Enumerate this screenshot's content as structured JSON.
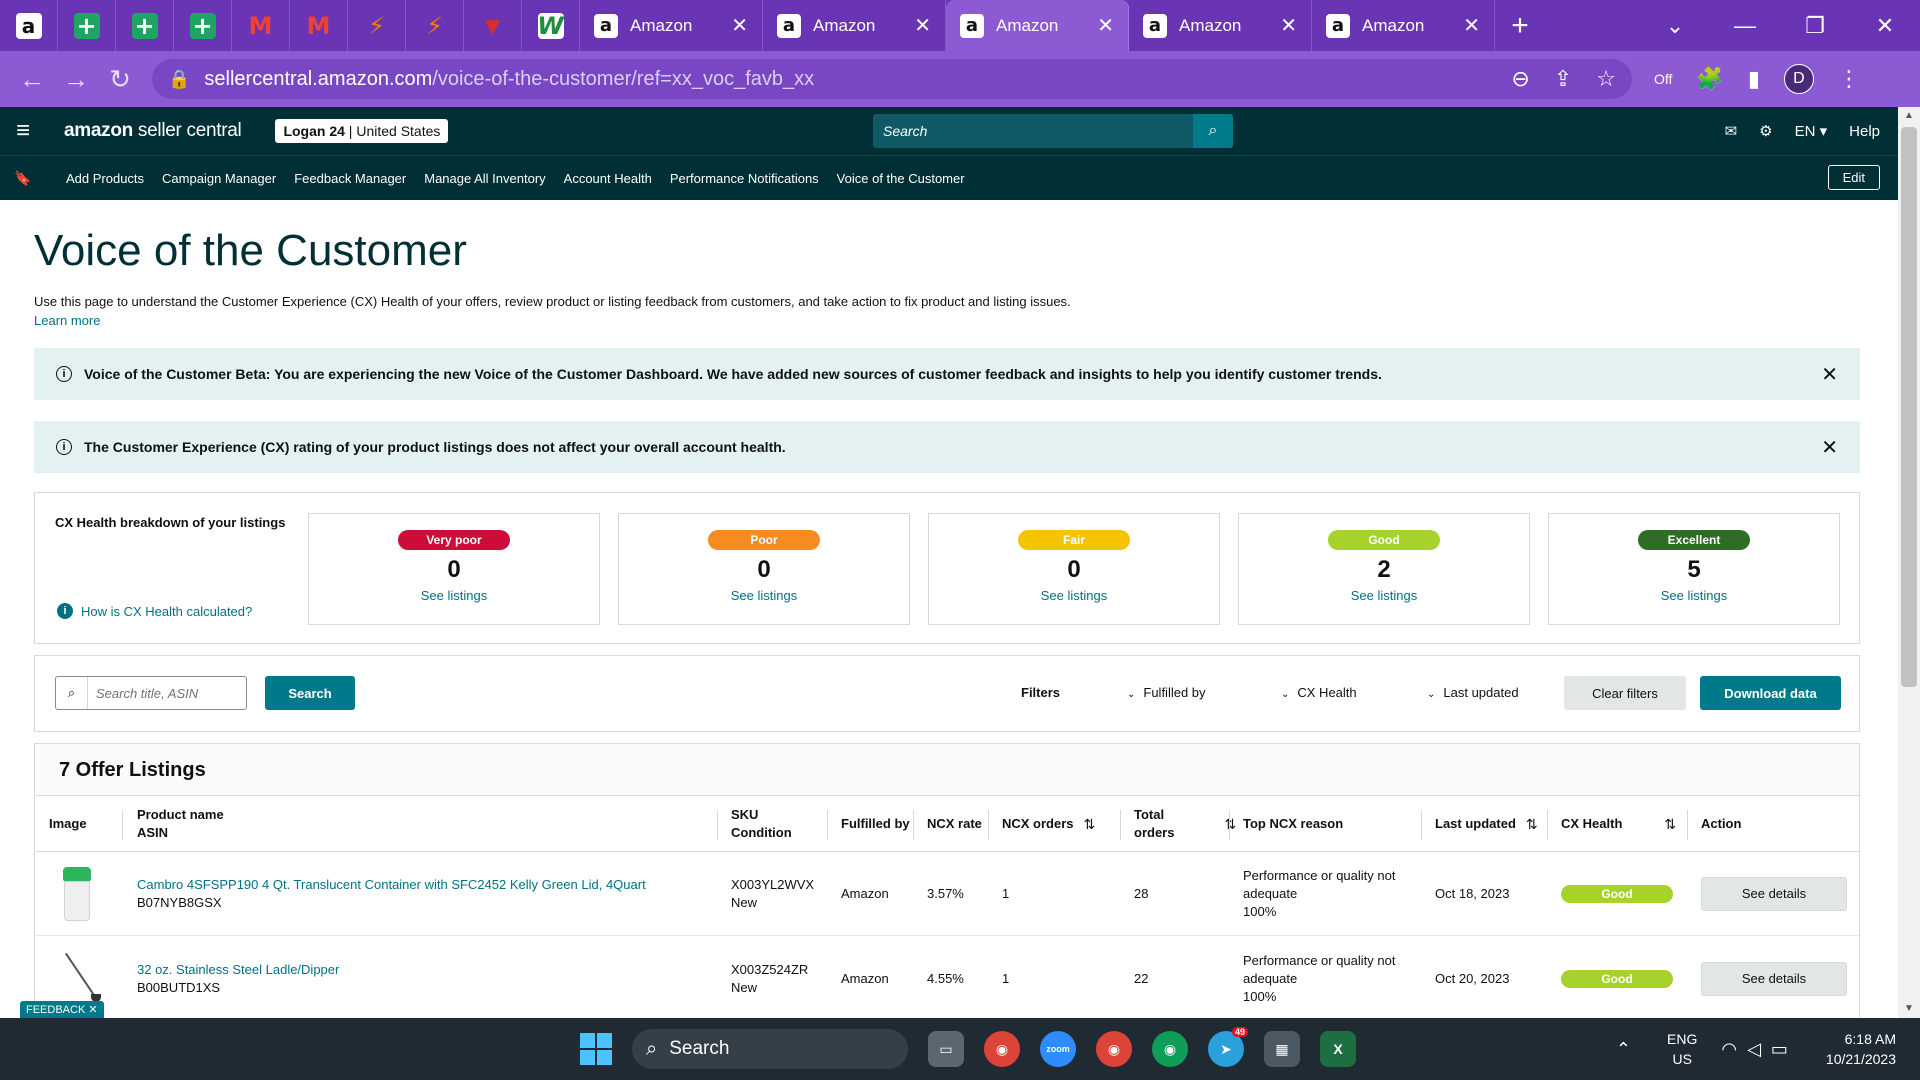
{
  "browser": {
    "tabs": [
      {
        "label": "Amazon",
        "active": false
      },
      {
        "label": "Amazon",
        "active": false
      },
      {
        "label": "Amazon",
        "active": true
      },
      {
        "label": "Amazon",
        "active": false
      },
      {
        "label": "Amazon",
        "active": false
      }
    ],
    "url_host": "sellercentral.amazon.com",
    "url_path": "/voice-of-the-customer/ref=xx_voc_favb_xx",
    "profile_initial": "D",
    "extension_badge": "Off"
  },
  "header": {
    "brand_bold": "amazon",
    "brand_rest": " seller central",
    "store_name": "Logan 24",
    "store_region": " | United States",
    "search_placeholder": "Search",
    "language": "EN",
    "help": "Help"
  },
  "bookmarks": {
    "items": [
      "Add Products",
      "Campaign Manager",
      "Feedback Manager",
      "Manage All Inventory",
      "Account Health",
      "Performance Notifications",
      "Voice of the Customer"
    ],
    "edit_label": "Edit"
  },
  "page": {
    "title": "Voice of the Customer",
    "intro": "Use this page to understand the Customer Experience (CX) Health of your offers, review product or listing feedback from customers, and take action to fix product and listing issues.",
    "learn_more": "Learn more",
    "banner1": "Voice of the Customer Beta: You are experiencing the new Voice of the Customer Dashboard. We have added new sources of customer feedback and insights to help you identify customer trends.",
    "banner2": "The Customer Experience (CX) rating of your product listings does not affect your overall account health."
  },
  "cx": {
    "title": "CX Health breakdown of your listings",
    "help_link": "How is CX Health calculated?",
    "cards": [
      {
        "label": "Very poor",
        "count": "0",
        "link": "See listings",
        "color": "#cc0c39"
      },
      {
        "label": "Poor",
        "count": "0",
        "link": "See listings",
        "color": "#f68b1f"
      },
      {
        "label": "Fair",
        "count": "0",
        "link": "See listings",
        "color": "#f5c400"
      },
      {
        "label": "Good",
        "count": "2",
        "link": "See listings",
        "color": "#a7d22b"
      },
      {
        "label": "Excellent",
        "count": "5",
        "link": "See listings",
        "color": "#2e6d24"
      }
    ]
  },
  "filters": {
    "search_placeholder": "Search title, ASIN",
    "search_button": "Search",
    "label": "Filters",
    "fulfilled_by": "Fulfilled by",
    "cx_health": "CX Health",
    "last_updated": "Last updated",
    "clear": "Clear filters",
    "download": "Download data"
  },
  "listings": {
    "title": "7 Offer Listings",
    "headers": {
      "image": "Image",
      "product_name": "Product name",
      "asin": "ASIN",
      "sku": "SKU",
      "condition": "Condition",
      "fulfilled_by": "Fulfilled by",
      "ncx_rate": "NCX rate",
      "ncx_orders": "NCX orders",
      "total": "Total",
      "orders": "orders",
      "top_reason": "Top NCX reason",
      "last_updated": "Last updated",
      "cx_health": "CX Health",
      "action": "Action"
    },
    "rows": [
      {
        "name": "Cambro 4SFSPP190 4 Qt. Translucent Container with SFC2452 Kelly Green Lid, 4Quart",
        "asin": "B07NYB8GSX",
        "sku": "X003YL2WVX",
        "condition": "New",
        "fulfilled": "Amazon",
        "ncx_rate": "3.57%",
        "ncx_orders": "1",
        "total_orders": "28",
        "reason_1": "Performance or quality not",
        "reason_2": "adequate",
        "reason_pct": "100%",
        "updated": "Oct 18, 2023",
        "health": "Good",
        "action": "See details"
      },
      {
        "name": "32 oz. Stainless Steel Ladle/Dipper",
        "asin": "B00BUTD1XS",
        "sku": "X003Z524ZR",
        "condition": "New",
        "fulfilled": "Amazon",
        "ncx_rate": "4.55%",
        "ncx_orders": "1",
        "total_orders": "22",
        "reason_1": "Performance or quality not",
        "reason_2": "adequate",
        "reason_pct": "100%",
        "updated": "Oct 20, 2023",
        "health": "Good",
        "action": "See details"
      }
    ]
  },
  "feedback_tab": "FEEDBACK",
  "taskbar": {
    "search": "Search",
    "lang_1": "ENG",
    "lang_2": "US",
    "time": "6:18 AM",
    "date": "10/21/2023",
    "telegram_badge": "49"
  }
}
